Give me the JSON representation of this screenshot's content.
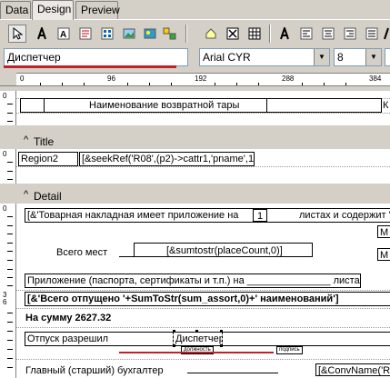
{
  "tabs": [
    {
      "label": "Data"
    },
    {
      "label": "Design"
    },
    {
      "label": "Preview"
    }
  ],
  "toolbar": {
    "icons": [
      "select-arrow-icon",
      "text-tool-icon",
      "label-tool-icon",
      "memo-tool-icon",
      "calc-field-icon",
      "image-tool-icon",
      "picture-db-icon",
      "barcode-icon",
      "band-icon",
      "checkbox-icon",
      "grid-icon",
      "font-a-icon",
      "align-left-icon",
      "align-center-icon",
      "align-right-icon",
      "align-justify-icon",
      "font-a2-icon"
    ]
  },
  "controls": {
    "component_name": "Диспетчер",
    "font_name": "Arial CYR",
    "font_size": "8"
  },
  "ruler": {
    "labels": [
      "0",
      "96",
      "192",
      "288",
      "384"
    ]
  },
  "bands": {
    "header": {
      "ruler_label": "0",
      "column_title": "Наименование возвратной тары",
      "right_col": "К"
    },
    "title": {
      "name": "Title",
      "ruler_label": "0",
      "region": "Region2",
      "expr": "[&seekRef('R08',(p2)->cattr1,'pname',1)]"
    },
    "detail": {
      "name": "Detail",
      "ruler_labels": [
        "0",
        "3",
        "6"
      ],
      "line1": "[&'Товарная накладная имеет приложение на",
      "line1_box": "1",
      "line1_tail": "листах и содержит '+S",
      "right_m1": "М",
      "right_m2": "М",
      "total_places_label": "Всего мест",
      "total_places_expr": "[&sumtostr(placeCount,0)]",
      "appendix": "Приложение (паспорта, сертификаты и т.п.) на _______________ листах",
      "released": "[&'Всего отпущено '+SumToStr(sum_assort,0)+' наименований']",
      "sum": "На сумму 2627.32",
      "release_allowed": "Отпуск разрешил",
      "dispatcher": "Диспетчер",
      "position_caption": "должность",
      "signature_caption": "подпись",
      "chief_accountant": "Главный (старший) бухгалтер",
      "conv_expr": "[&ConvName('R1"
    }
  },
  "colors": {
    "highlight_red": "#c0202a",
    "chrome": "#d4d0c8"
  }
}
